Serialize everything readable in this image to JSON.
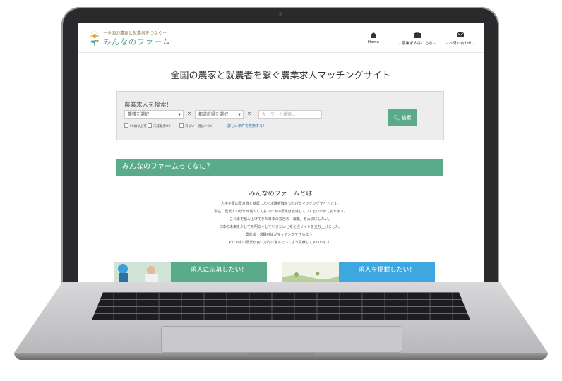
{
  "header": {
    "logo_tagline": "－全国の農家と就農者をつなぐ－",
    "logo_name": "みんなのファーム",
    "nav": [
      {
        "label": "- Home -",
        "icon": "home-icon"
      },
      {
        "label": "- 農業求人はこちら -",
        "icon": "briefcase-icon"
      },
      {
        "label": "- お問い合わせ -",
        "icon": "envelope-icon"
      }
    ]
  },
  "hero": {
    "title": "全国の農家と就農者を繋ぐ農業求人マッチングサイト"
  },
  "search": {
    "title": "農業求人を検索！",
    "industry_select": "業種を選択",
    "prefecture_select": "都道府県を選択",
    "keyword_placeholder": "キーワード検索...",
    "clear_mark": "×",
    "checkboxes": [
      "50歳以上可",
      "未経験者OK",
      "日払い・週払いOK"
    ],
    "advanced_link": "詳しい条件で検索する！",
    "button_label": "検索",
    "button_icon": "search-icon"
  },
  "about": {
    "section_heading": "みんなのファームってなに？",
    "subtitle": "みんなのファームとは",
    "lines": [
      "人手不足の農家様と就農したい求職者様をつなげるマッチングサイトです。",
      "現在、農業人口が年々減少しており日本の農業は衰退していくといわれております。",
      "これまで積み上げてきた日本の独自の「農業」を大切にしたい。",
      "日本の未来を少しでも明るくしていきたいと考え当サイトを立ち上げました。",
      "農家様・求職者様がマッチングできるよう、",
      "また日本の農業が良い方向へ進んでいくよう貢献してまいります。"
    ]
  },
  "cards": [
    {
      "label": "求人に応募したい！",
      "color": "#5aaa8c"
    },
    {
      "label": "求人を掲載したい！",
      "color": "#3ea7e0"
    }
  ],
  "colors": {
    "accent": "#5aaa8c",
    "link": "#2d6fa6",
    "bezel": "#2a2a2c"
  }
}
